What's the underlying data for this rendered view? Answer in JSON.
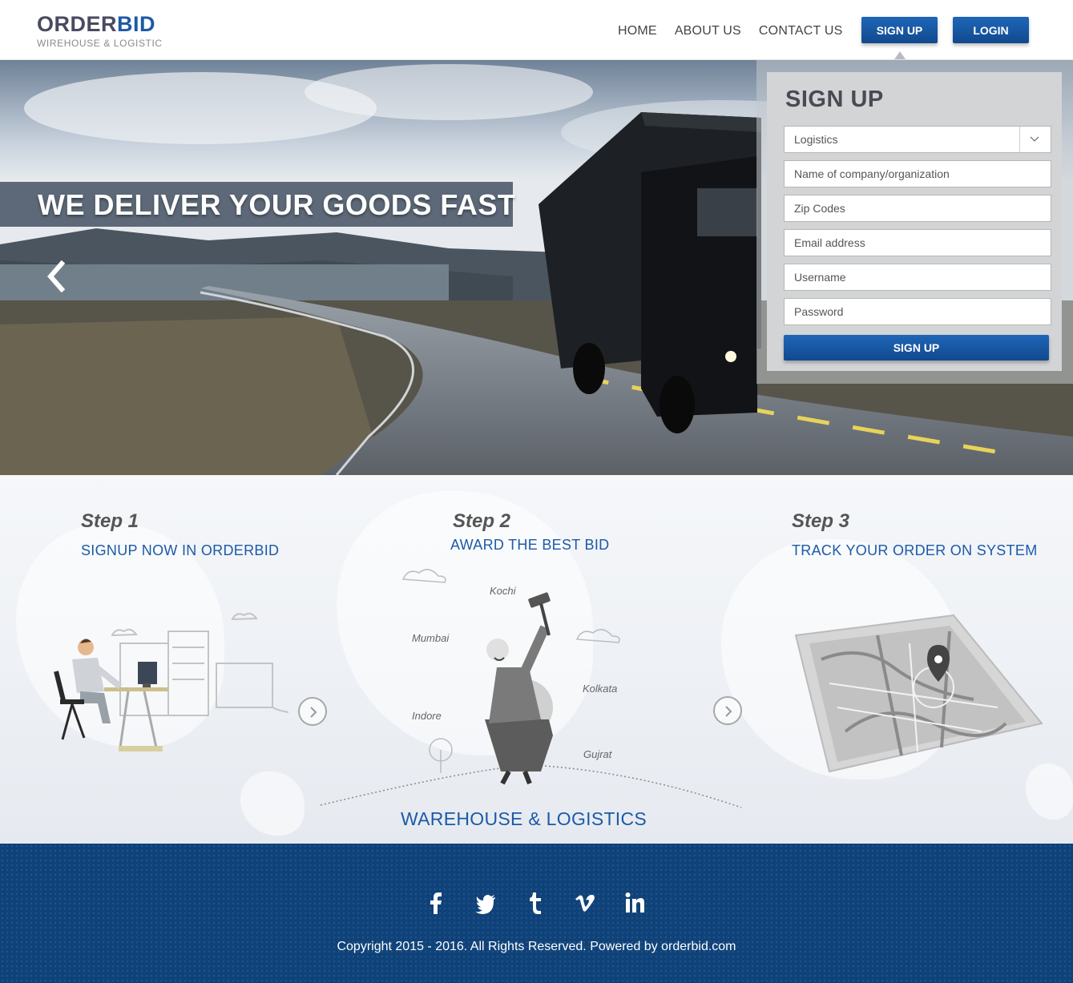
{
  "brand": {
    "name_part1": "ORDER",
    "name_part2": "BID",
    "tagline": "WIREHOUSE & LOGISTIC"
  },
  "nav": {
    "items": [
      {
        "label": "HOME"
      },
      {
        "label": "ABOUT US"
      },
      {
        "label": "CONTACT US"
      }
    ]
  },
  "header": {
    "signup_label": "SIGN UP",
    "login_label": "LOGIN"
  },
  "hero": {
    "slogan": "WE DELIVER YOUR GOODS FAST",
    "prev_glyph": "‹"
  },
  "signup_form": {
    "title": "SIGN UP",
    "category_selected": "Logistics",
    "fields": {
      "company_placeholder": "Name of company/organization",
      "zip_placeholder": "Zip Codes",
      "email_placeholder": "Email address",
      "username_placeholder": "Username",
      "password_placeholder": "Password"
    },
    "submit_label": "SIGN UP"
  },
  "steps": [
    {
      "number": "Step 1",
      "title": "SIGNUP NOW IN ORDERBID"
    },
    {
      "number": "Step 2",
      "title": "AWARD THE BEST BID"
    },
    {
      "number": "Step 3",
      "title": "TRACK YOUR ORDER ON SYSTEM"
    }
  ],
  "cities": [
    "Kochi",
    "Mumbai",
    "Kolkata",
    "Indore",
    "Gujrat"
  ],
  "section_footer_title": "WAREHOUSE & LOGISTICS",
  "footer": {
    "social": [
      {
        "name": "facebook-icon",
        "glyph": "f"
      },
      {
        "name": "twitter-icon",
        "glyph": "t"
      },
      {
        "name": "tumblr-icon",
        "glyph": "t"
      },
      {
        "name": "vimeo-icon",
        "glyph": "v"
      },
      {
        "name": "linkedin-icon",
        "glyph": "in"
      }
    ],
    "copyright": "Copyright 2015 - 2016. All Rights Reserved. Powered by orderbid.com"
  },
  "colors": {
    "brand_blue": "#1d5aa7",
    "button_blue": "#1a5cab",
    "footer_blue": "#0e4279",
    "logo_dark": "#4a4a60"
  }
}
